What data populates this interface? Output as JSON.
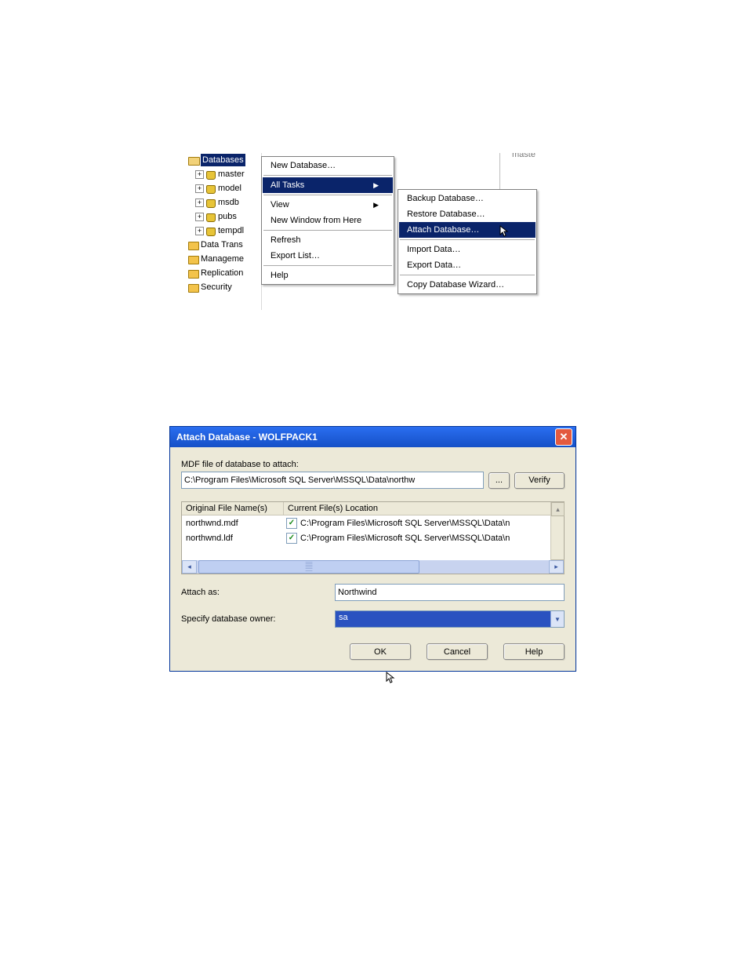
{
  "tree": {
    "root_label": "Databases",
    "children": [
      "master",
      "model",
      "msdb",
      "pubs",
      "tempdl"
    ],
    "siblings": [
      "Data Trans",
      "Manageme",
      "Replication",
      "Security"
    ]
  },
  "blur_text": "maste",
  "context_menu_1": {
    "new_db": "New Database…",
    "all_tasks": "All Tasks",
    "view": "View",
    "new_window": "New Window from Here",
    "refresh": "Refresh",
    "export_list": "Export List…",
    "help": "Help"
  },
  "context_menu_2": {
    "backup": "Backup Database…",
    "restore": "Restore Database…",
    "attach": "Attach Database…",
    "import": "Import Data…",
    "export": "Export Data…",
    "copy_wizard": "Copy Database Wizard…"
  },
  "dialog": {
    "title": "Attach Database - WOLFPACK1",
    "mdf_label": "MDF file of database to attach:",
    "mdf_path": "C:\\Program Files\\Microsoft SQL Server\\MSSQL\\Data\\northw",
    "browse_label": "...",
    "verify_label": "Verify",
    "col_original": "Original File Name(s)",
    "col_current": "Current File(s) Location",
    "rows": [
      {
        "orig": "northwnd.mdf",
        "loc": "C:\\Program Files\\Microsoft SQL Server\\MSSQL\\Data\\n"
      },
      {
        "orig": "northwnd.ldf",
        "loc": "C:\\Program Files\\Microsoft SQL Server\\MSSQL\\Data\\n"
      }
    ],
    "attach_as_label": "Attach as:",
    "attach_as_value": "Northwind",
    "owner_label": "Specify database owner:",
    "owner_value": "sa",
    "ok": "OK",
    "cancel": "Cancel",
    "help": "Help"
  }
}
